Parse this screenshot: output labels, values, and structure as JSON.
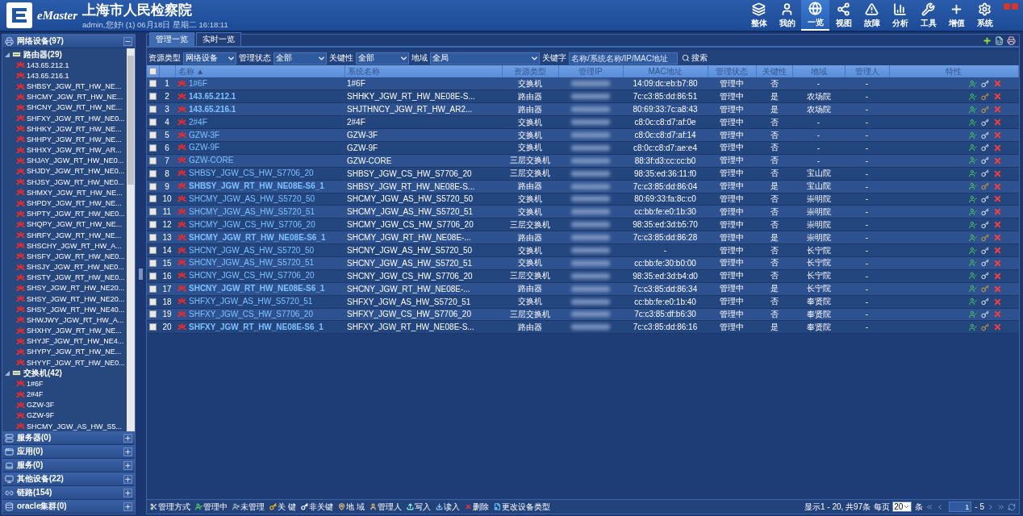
{
  "header": {
    "logo": "eMaster",
    "title": "上海市人民检察院",
    "subtitle": "admin,您好! (1) 06月18日 星期二 16:18:11",
    "nav": [
      {
        "label": "整体",
        "selected": false
      },
      {
        "label": "我的",
        "selected": false
      },
      {
        "label": "一览",
        "selected": true
      },
      {
        "label": "视图",
        "selected": false
      },
      {
        "label": "故障",
        "selected": false
      },
      {
        "label": "分析",
        "selected": false
      },
      {
        "label": "工具",
        "selected": false
      },
      {
        "label": "增值",
        "selected": false
      },
      {
        "label": "系统",
        "selected": false
      }
    ]
  },
  "sidebar": {
    "sections": [
      {
        "label": "网络设备(97)",
        "expanded": true,
        "children": [
          {
            "label": "路由器(29)",
            "expanded": true,
            "children": [
              {
                "label": "143.65.212.1"
              },
              {
                "label": "143.65.216.1"
              },
              {
                "label": "SHBSY_JGW_RT_HW_NE..."
              },
              {
                "label": "SHCMY_JGW_RT_HW_NE..."
              },
              {
                "label": "SHCNY_JGW_RT_HW_NE..."
              },
              {
                "label": "SHFXY_JGW_RT_HW_NE0..."
              },
              {
                "label": "SHHKY_JGW_RT_HW_NE..."
              },
              {
                "label": "SHHPY_JGW_RT_HW_NE..."
              },
              {
                "label": "SHHXY_JGW_RT_HW_AR..."
              },
              {
                "label": "SHJAY_JGW_RT_HW_NE0..."
              },
              {
                "label": "SHJDY_JGW_RT_HW_NE0..."
              },
              {
                "label": "SHJSY_JGW_RT_HW_NE0..."
              },
              {
                "label": "SHMXY_JGW_RT_HW_NE..."
              },
              {
                "label": "SHPDY_JGW_RT_HW_NE..."
              },
              {
                "label": "SHPTY_JGW_RT_HW_NE0..."
              },
              {
                "label": "SHQPY_JGW_RT_HW_NE..."
              },
              {
                "label": "SHRFY_JGW_RT_HW_NE..."
              },
              {
                "label": "SHSCHY_JGW_RT_HW_A..."
              },
              {
                "label": "SHSFY_JGW_RT_HW_NE0..."
              },
              {
                "label": "SHSJY_JGW_RT_HW_NE0..."
              },
              {
                "label": "SHSTY_JGW_RT_HW_NE0..."
              },
              {
                "label": "SHSY_JGW_RT_HW_NE20..."
              },
              {
                "label": "SHSY_JGW_RT_HW_NE20..."
              },
              {
                "label": "SHSY_JGW_RT_HW_NE40..."
              },
              {
                "label": "SHWJWY_JGW_RT_HW_A..."
              },
              {
                "label": "SHXHY_JGW_RT_HW_NE..."
              },
              {
                "label": "SHYJF_JGW_RT_HW_NE4..."
              },
              {
                "label": "SHYPY_JGW_RT_HW_NE..."
              },
              {
                "label": "SHYYF_JGW_RT_HW_NE0..."
              }
            ]
          },
          {
            "label": "交换机(42)",
            "expanded": true,
            "children": [
              {
                "label": "1#6F"
              },
              {
                "label": "2#4F"
              },
              {
                "label": "GZW-3F"
              },
              {
                "label": "GZW-9F"
              },
              {
                "label": "SHCMY_JGW_AS_HW_S5..."
              }
            ]
          }
        ]
      },
      {
        "label": "服务器(0)",
        "expanded": false
      },
      {
        "label": "应用(0)",
        "expanded": false
      },
      {
        "label": "服务(0)",
        "expanded": false
      },
      {
        "label": "其他设备(22)",
        "expanded": false
      },
      {
        "label": "链路(154)",
        "expanded": false
      },
      {
        "label": "oracle集群(0)",
        "expanded": false
      }
    ]
  },
  "tabs": [
    {
      "label": "管理一览",
      "selected": true
    },
    {
      "label": "实时一览",
      "selected": false
    }
  ],
  "filters": [
    {
      "kind": "select",
      "label": "资源类型",
      "value": "网络设备"
    },
    {
      "kind": "select",
      "label": "管理状态",
      "value": "全部"
    },
    {
      "kind": "select",
      "label": "关键性",
      "value": "全部"
    },
    {
      "kind": "select",
      "label": "地域",
      "value": "全局"
    },
    {
      "kind": "text",
      "label": "关键字",
      "placeholder": "名称/系统名称/IP/MAC地址"
    }
  ],
  "search_button": "搜索",
  "table": {
    "select_all_checked": false,
    "columns": [
      {
        "label": "名称",
        "sort": "▲"
      },
      {
        "label": "系统名称"
      },
      {
        "label": "资源类型"
      },
      {
        "label": "管理IP"
      },
      {
        "label": "MAC地址"
      },
      {
        "label": "管理状态"
      },
      {
        "label": "关键性"
      },
      {
        "label": "地域"
      },
      {
        "label": "管理人"
      },
      {
        "label": "特性"
      }
    ],
    "rows": [
      {
        "index": "1",
        "checked": false,
        "name": "1#6F",
        "sysname": "1#6F",
        "type": "交换机",
        "mac": "14:09:dc:eb:b7:80",
        "status": "管理中",
        "critical_text": "否",
        "critical": false,
        "region": "-",
        "manager": "-"
      },
      {
        "index": "2",
        "checked": false,
        "name": "143.65.212.1",
        "sysname": "SHHKY_JGW_RT_HW_NE08E-S...",
        "type": "路由器",
        "mac": "7c:c3:85:dd:86:51",
        "status": "管理中",
        "critical_text": "是",
        "critical": true,
        "region": "农场院",
        "manager": "-"
      },
      {
        "index": "3",
        "checked": false,
        "name": "143.65.216.1",
        "sysname": "SHJTHNCY_JGW_RT_HW_AR2...",
        "type": "路由器",
        "mac": "80:69:33:7c:a8:43",
        "status": "管理中",
        "critical_text": "是",
        "critical": true,
        "region": "农场院",
        "manager": "-"
      },
      {
        "index": "4",
        "checked": false,
        "name": "2#4F",
        "sysname": "2#4F",
        "type": "交换机",
        "mac": "c8:0c:c8:d7:af:0e",
        "status": "管理中",
        "critical_text": "否",
        "critical": false,
        "region": "-",
        "manager": "-"
      },
      {
        "index": "5",
        "checked": false,
        "name": "GZW-3F",
        "sysname": "GZW-3F",
        "type": "交换机",
        "mac": "c8:0c:c8:d7:af:14",
        "status": "管理中",
        "critical_text": "否",
        "critical": false,
        "region": "-",
        "manager": "-"
      },
      {
        "index": "6",
        "checked": false,
        "name": "GZW-9F",
        "sysname": "GZW-9F",
        "type": "交换机",
        "mac": "c8:0c:c8:d7:ae:e4",
        "status": "管理中",
        "critical_text": "否",
        "critical": false,
        "region": "-",
        "manager": "-"
      },
      {
        "index": "7",
        "checked": false,
        "name": "GZW-CORE",
        "sysname": "GZW-CORE",
        "type": "三层交换机",
        "mac": "88:3f:d3:cc:cc:b0",
        "status": "管理中",
        "critical_text": "否",
        "critical": false,
        "region": "-",
        "manager": "-"
      },
      {
        "index": "8",
        "checked": false,
        "name": "SHBSY_JGW_CS_HW_S7706_20",
        "sysname": "SHBSY_JGW_CS_HW_S7706_20",
        "type": "三层交换机",
        "mac": "98:35:ed:36:11:f0",
        "status": "管理中",
        "critical_text": "否",
        "critical": false,
        "region": "宝山院",
        "manager": "-"
      },
      {
        "index": "9",
        "checked": false,
        "name": "SHBSY_JGW_RT_HW_NE08E-S6_1",
        "sysname": "SHBSY_JGW_RT_HW_NE08E-S...",
        "type": "路由器",
        "mac": "7c:c3:85:dd:86:04",
        "status": "管理中",
        "critical_text": "是",
        "critical": true,
        "region": "宝山院",
        "manager": "-"
      },
      {
        "index": "10",
        "checked": false,
        "name": "SHCMY_JGW_AS_HW_S5720_50",
        "sysname": "SHCMY_JGW_AS_HW_S5720_50",
        "type": "交换机",
        "mac": "80:69:33:fa:8c:c0",
        "status": "管理中",
        "critical_text": "否",
        "critical": false,
        "region": "崇明院",
        "manager": "-"
      },
      {
        "index": "11",
        "checked": false,
        "name": "SHCMY_JGW_AS_HW_S5720_51",
        "sysname": "SHCMY_JGW_AS_HW_S5720_51",
        "type": "交换机",
        "mac": "cc:bb:fe:e0:1b:30",
        "status": "管理中",
        "critical_text": "否",
        "critical": false,
        "region": "崇明院",
        "manager": "-"
      },
      {
        "index": "12",
        "checked": false,
        "name": "SHCMY_JGW_CS_HW_S7706_20",
        "sysname": "SHCMY_JGW_CS_HW_S7706_20",
        "type": "三层交换机",
        "mac": "98:35:ed:3d:b5:70",
        "status": "管理中",
        "critical_text": "否",
        "critical": false,
        "region": "崇明院",
        "manager": "-"
      },
      {
        "index": "13",
        "checked": false,
        "name": "SHCMY_JGW_RT_HW_NE08E-S6_1",
        "sysname": "SHCMY_JGW_RT_HW_NE08E-...",
        "type": "路由器",
        "mac": "7c:c3:85:dd:86:28",
        "status": "管理中",
        "critical_text": "是",
        "critical": true,
        "region": "崇明院",
        "manager": "-"
      },
      {
        "index": "14",
        "checked": false,
        "name": "SHCNY_JGW_AS_HW_S5720_50",
        "sysname": "SHCNY_JGW_AS_HW_S5720_50",
        "type": "交换机",
        "mac": "-",
        "status": "管理中",
        "critical_text": "否",
        "critical": false,
        "region": "长宁院",
        "manager": "-"
      },
      {
        "index": "15",
        "checked": false,
        "name": "SHCNY_JGW_AS_HW_S5720_51",
        "sysname": "SHCNY_JGW_AS_HW_S5720_51",
        "type": "交换机",
        "mac": "cc:bb:fe:30:b0:00",
        "status": "管理中",
        "critical_text": "否",
        "critical": false,
        "region": "长宁院",
        "manager": "-"
      },
      {
        "index": "16",
        "checked": false,
        "name": "SHCNY_JGW_CS_HW_S7706_20",
        "sysname": "SHCNY_JGW_CS_HW_S7706_20",
        "type": "三层交换机",
        "mac": "98:35:ed:3d:b4:d0",
        "status": "管理中",
        "critical_text": "否",
        "critical": false,
        "region": "长宁院",
        "manager": "-"
      },
      {
        "index": "17",
        "checked": false,
        "name": "SHCNY_JGW_RT_HW_NE08E-S6_1",
        "sysname": "SHCNY_JGW_RT_HW_NE08E-...",
        "type": "路由器",
        "mac": "7c:c3:85:dd:86:34",
        "status": "管理中",
        "critical_text": "是",
        "critical": true,
        "region": "长宁院",
        "manager": "-"
      },
      {
        "index": "18",
        "checked": false,
        "name": "SHFXY_JGW_AS_HW_S5720_51",
        "sysname": "SHFXY_JGW_AS_HW_S5720_51",
        "type": "交换机",
        "mac": "cc:bb:fe:e0:1b:40",
        "status": "管理中",
        "critical_text": "否",
        "critical": false,
        "region": "奉贤院",
        "manager": "-"
      },
      {
        "index": "19",
        "checked": false,
        "name": "SHFXY_JGW_CS_HW_S7706_20",
        "sysname": "SHFXY_JGW_CS_HW_S7706_20",
        "type": "三层交换机",
        "mac": "7c:c3:85:df:b6:30",
        "status": "管理中",
        "critical_text": "否",
        "critical": false,
        "region": "奉贤院",
        "manager": "-"
      },
      {
        "index": "20",
        "checked": false,
        "name": "SHFXY_JGW_RT_HW_NE08E-S6_1",
        "sysname": "SHFXY_JGW_RT_HW_NE08E-S...",
        "type": "路由器",
        "mac": "7c:c3:85:dd:86:16",
        "status": "管理中",
        "critical_text": "是",
        "critical": true,
        "region": "奉贤院",
        "manager": "-"
      }
    ]
  },
  "toolbar": [
    {
      "label": "管理方式"
    },
    {
      "label": "管理中"
    },
    {
      "label": "未管理"
    },
    {
      "label": "关 键"
    },
    {
      "label": "非关键"
    },
    {
      "label": "地 域"
    },
    {
      "label": "管理人"
    },
    {
      "label": "写入"
    },
    {
      "label": "读入"
    },
    {
      "label": "删除"
    },
    {
      "label": "更改设备类型"
    }
  ],
  "pager": {
    "summary": "显示1 - 20, 共97条",
    "per_page_label": "每页",
    "per_page": "20",
    "per_page_unit": "条",
    "page": "1",
    "page_total": "- 5"
  }
}
